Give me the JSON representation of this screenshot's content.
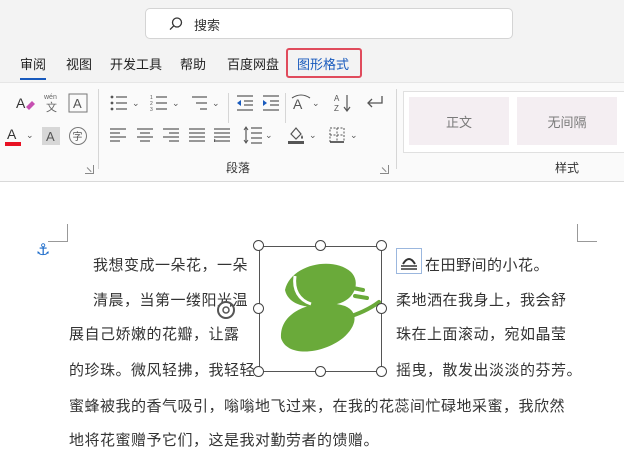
{
  "search": {
    "placeholder": "搜索"
  },
  "tabs": [
    {
      "label": "审阅"
    },
    {
      "label": "视图"
    },
    {
      "label": "开发工具"
    },
    {
      "label": "帮助"
    },
    {
      "label": "百度网盘"
    },
    {
      "label": "图形格式"
    }
  ],
  "ribbon": {
    "paragraph_label": "段落",
    "styles_label": "样式",
    "styles": [
      {
        "label": "正文"
      },
      {
        "label": "无间隔"
      }
    ],
    "accent_red": "#e81123"
  },
  "document": {
    "lines": [
      {
        "text": "我想变成一朵花，一朵",
        "tail": "在田野间的小花。"
      },
      {
        "text": "清晨，当第一缕阳光温",
        "tail": "柔地洒在我身上，我会舒"
      },
      {
        "text": "展自己娇嫩的花瓣，让露",
        "tail": "珠在上面滚动，宛如晶莹"
      },
      {
        "text": "的珍珠。微风轻拂，我轻轻",
        "tail": "摇曳，散发出淡淡的芬芳。"
      },
      {
        "text": "蜜蜂被我的香气吸引，嗡嗡地飞过来，在我的花蕊间忙碌地采蜜，我欣然"
      },
      {
        "text": "地将花蜜赠予它们，这是我对勤劳者的馈赠。"
      }
    ],
    "image_color": "#6aaa3a"
  }
}
